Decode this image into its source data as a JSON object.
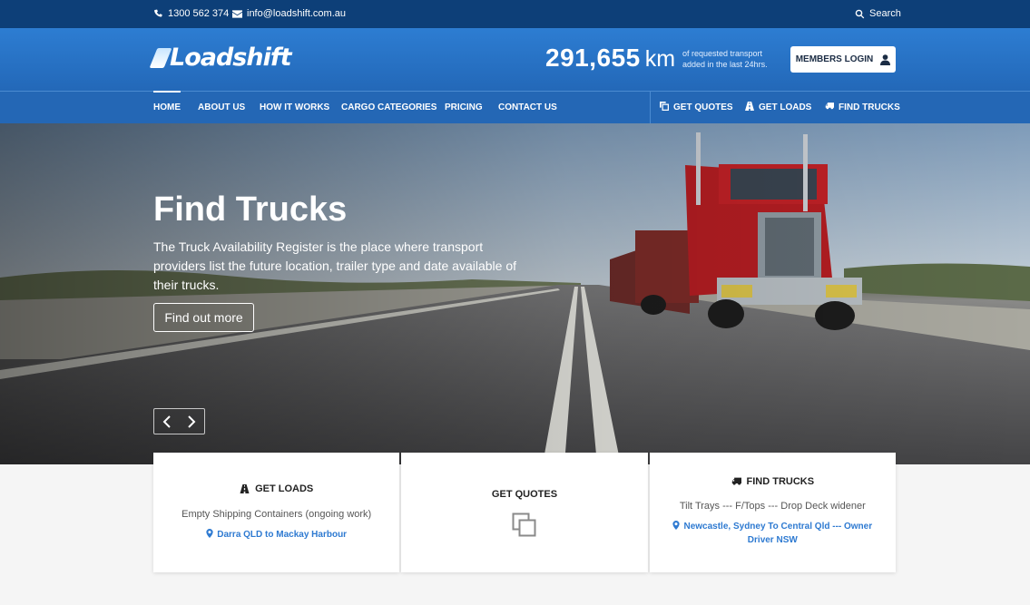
{
  "topbar": {
    "phone": "1300 562 374",
    "email": "info@loadshift.com.au",
    "search_label": "Search"
  },
  "header": {
    "logo_text": "Loadshift",
    "counter_value": "291,655",
    "counter_unit": "km",
    "counter_desc": "of requested transport added in the last 24hrs.",
    "login_label": "MEMBERS LOGIN"
  },
  "nav": {
    "main": [
      {
        "label": "HOME"
      },
      {
        "label": "ABOUT US"
      },
      {
        "label": "HOW IT WORKS"
      },
      {
        "label": "CARGO CATEGORIES"
      },
      {
        "label": "PRICING"
      },
      {
        "label": "CONTACT US"
      }
    ],
    "actions": [
      {
        "label": "GET QUOTES",
        "icon": "copy-icon"
      },
      {
        "label": "GET LOADS",
        "icon": "road-icon"
      },
      {
        "label": "FIND TRUCKS",
        "icon": "truck-icon"
      }
    ]
  },
  "hero": {
    "title": "Find Trucks",
    "text": "The Truck Availability Register is the place where transport providers list the future location, trailer type and date available of their trucks.",
    "button_label": "Find out more"
  },
  "cards": [
    {
      "title": "GET LOADS",
      "icon": "road-icon",
      "subtitle": "Empty Shipping Containers (ongoing work)",
      "link": "Darra QLD to Mackay Harbour"
    },
    {
      "title": "GET QUOTES",
      "icon": "copy-icon"
    },
    {
      "title": "FIND TRUCKS",
      "icon": "truck-icon",
      "subtitle": "Tilt Trays --- F/Tops --- Drop Deck widener",
      "link": "Newcastle, Sydney To Central Qld --- Owner Driver NSW"
    }
  ],
  "colors": {
    "topbar": "#0d3f78",
    "header": "#2d7dd2",
    "nav": "#2467b5",
    "link": "#2e7ad1"
  }
}
